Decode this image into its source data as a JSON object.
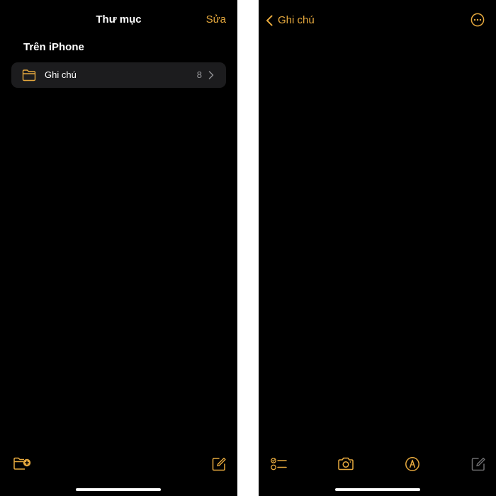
{
  "colors": {
    "accent": "#e6a93e",
    "background": "#000000",
    "row_background": "#1c1c1e",
    "text_primary": "#ffffff",
    "text_secondary": "#9a9a9e",
    "disabled_icon": "#6e6e70"
  },
  "folders_screen": {
    "title": "Thư mục",
    "edit_label": "Sửa",
    "section_title": "Trên iPhone",
    "folders": [
      {
        "label": "Ghi chú",
        "count": "8",
        "icon": "folder-icon"
      }
    ],
    "toolbar": {
      "new_folder_icon": "new-folder-icon",
      "compose_icon": "compose-icon"
    }
  },
  "note_screen": {
    "back_label": "Ghi chú",
    "more_icon": "ellipsis-circle-icon",
    "toolbar": {
      "checklist_icon": "checklist-icon",
      "camera_icon": "camera-icon",
      "markup_icon": "markup-pen-icon",
      "compose_icon": "compose-icon",
      "compose_enabled": false
    }
  }
}
